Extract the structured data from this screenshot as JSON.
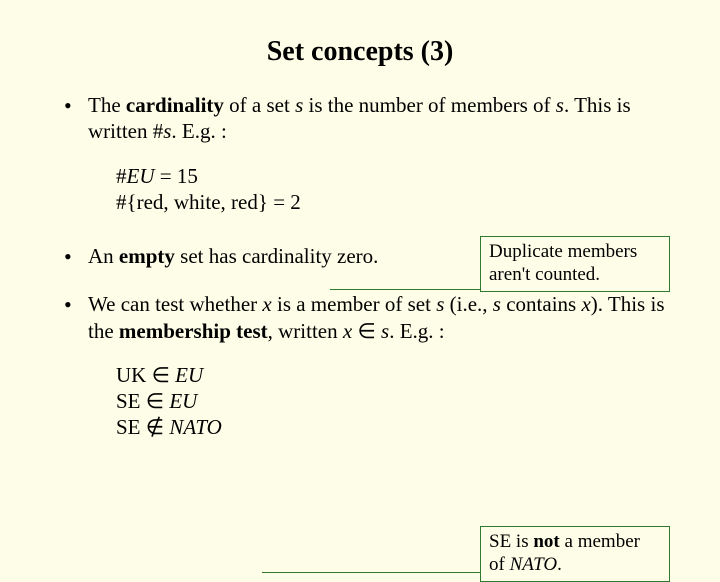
{
  "title": "Set concepts (3)",
  "bullet1": {
    "prefix": "The ",
    "cardinality": "cardinality",
    "mid1": " of a set ",
    "s1": "s",
    "mid2": " is the number of members of ",
    "s2": "s",
    "tail": ". This is written #",
    "s3": "s",
    "eg": ". E.g. :"
  },
  "example1": {
    "hash1": "#",
    "eu": "EU",
    "eq15": "  =  15",
    "line2": "#{red, white, red}  =  2"
  },
  "callout1": {
    "line1": "Duplicate members",
    "line2": "aren't counted."
  },
  "bullet2": {
    "prefix": "An ",
    "empty": "empty",
    "tail": " set has cardinality zero."
  },
  "bullet3": {
    "prefix": "We can test whether ",
    "x1": "x",
    "mid1": " is a member of set ",
    "s1": "s",
    "mid2": " (i.e., ",
    "s2": "s",
    "mid3": " contains ",
    "x2": "x",
    "mid4": "). This is the ",
    "membership": "membership test",
    "mid5": ", written ",
    "x3": "x",
    "in": " ∈ ",
    "s3": "s",
    "eg": ". E.g. :"
  },
  "example2": {
    "uk": "UK",
    "in1": " ∈ ",
    "eu1": "EU",
    "se1": "SE",
    "in2": " ∈ ",
    "eu2": "EU",
    "se2": "SE",
    "notin": " ∉ ",
    "nato": "NATO"
  },
  "callout2": {
    "pre": "SE is ",
    "not": "not",
    "mid": " a member",
    "line2_pre": "of ",
    "nato": "NATO",
    "line2_post": "."
  }
}
